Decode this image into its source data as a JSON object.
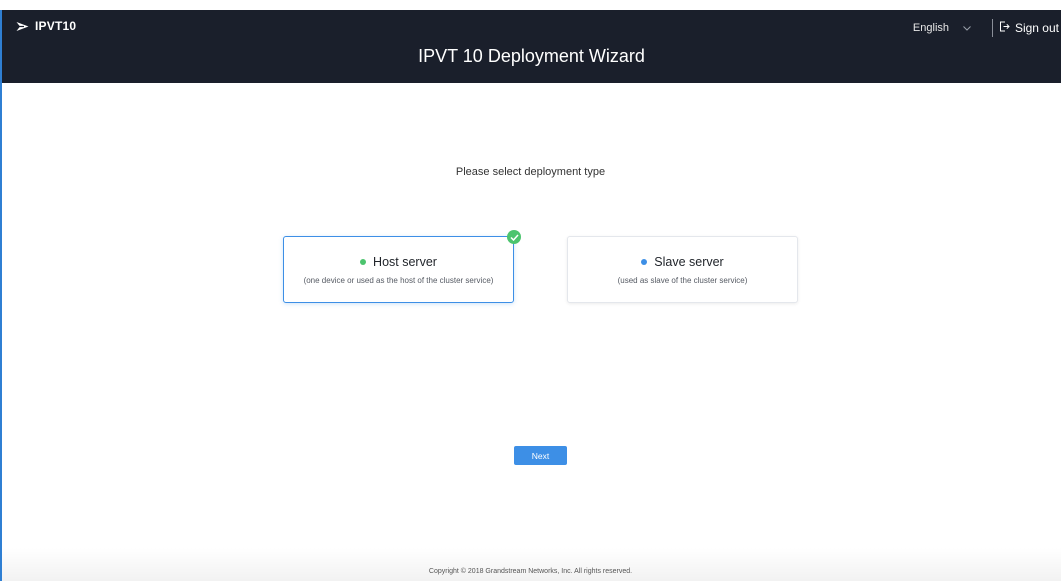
{
  "header": {
    "app_name": "IPVT10",
    "title": "IPVT 10 Deployment Wizard",
    "language": "English",
    "sign_out": "Sign out"
  },
  "main": {
    "prompt": "Please select deployment type",
    "options": [
      {
        "title": "Host server",
        "description": "(one device or used as the host of the cluster service)",
        "selected": true,
        "dot_color": "#4cc46e"
      },
      {
        "title": "Slave server",
        "description": "(used as slave of the cluster service)",
        "selected": false,
        "dot_color": "#3d8fe6"
      }
    ],
    "next_label": "Next"
  },
  "footer": {
    "copyright": "Copyright © 2018 Grandstream Networks, Inc. All rights reserved."
  },
  "colors": {
    "header_bg": "#1a1f2b",
    "accent": "#3d8fe6",
    "success": "#4cc46e"
  }
}
